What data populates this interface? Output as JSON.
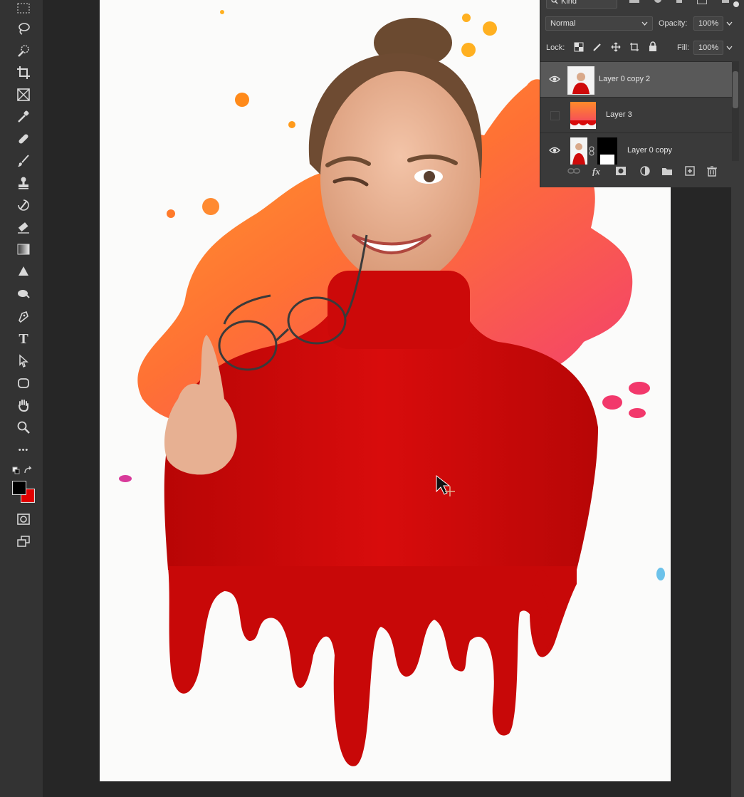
{
  "layers_panel": {
    "filter_kind": "Kind",
    "blend_mode": "Normal",
    "opacity_label": "Opacity:",
    "opacity_value": "100%",
    "lock_label": "Lock:",
    "fill_label": "Fill:",
    "fill_value": "100%",
    "layers": [
      {
        "name": "Layer 0 copy 2",
        "visible": true,
        "selected": true
      },
      {
        "name": "Layer 3",
        "visible": false,
        "selected": false
      },
      {
        "name": "Layer 0 copy",
        "visible": true,
        "selected": false,
        "has_mask": true
      }
    ],
    "bottom_icons": [
      "link-icon",
      "fx-icon",
      "add-mask-icon",
      "adjustment-icon",
      "group-folder-icon",
      "new-layer-icon",
      "trash-icon"
    ]
  },
  "toolbar": {
    "tools": [
      "marquee-tool",
      "lasso-tool",
      "quick-select-tool",
      "crop-tool",
      "frame-tool",
      "eyedropper-tool",
      "healing-tool",
      "brush-tool",
      "stamp-tool",
      "history-brush-tool",
      "eraser-tool",
      "gradient-tool",
      "blur-tool",
      "dodge-tool",
      "pen-tool",
      "type-tool",
      "path-select-tool",
      "shape-tool",
      "hand-tool",
      "zoom-tool",
      "more-tools"
    ],
    "type_tool_glyph": "T",
    "more_glyph": "•••",
    "foreground_color": "#000000",
    "background_color": "#e00000"
  },
  "colors": {
    "sweater": "#cf0a0a",
    "splash_orange": "#ff7a1a",
    "splash_pink": "#f0386b",
    "document_bg": "#fbfbfa"
  }
}
